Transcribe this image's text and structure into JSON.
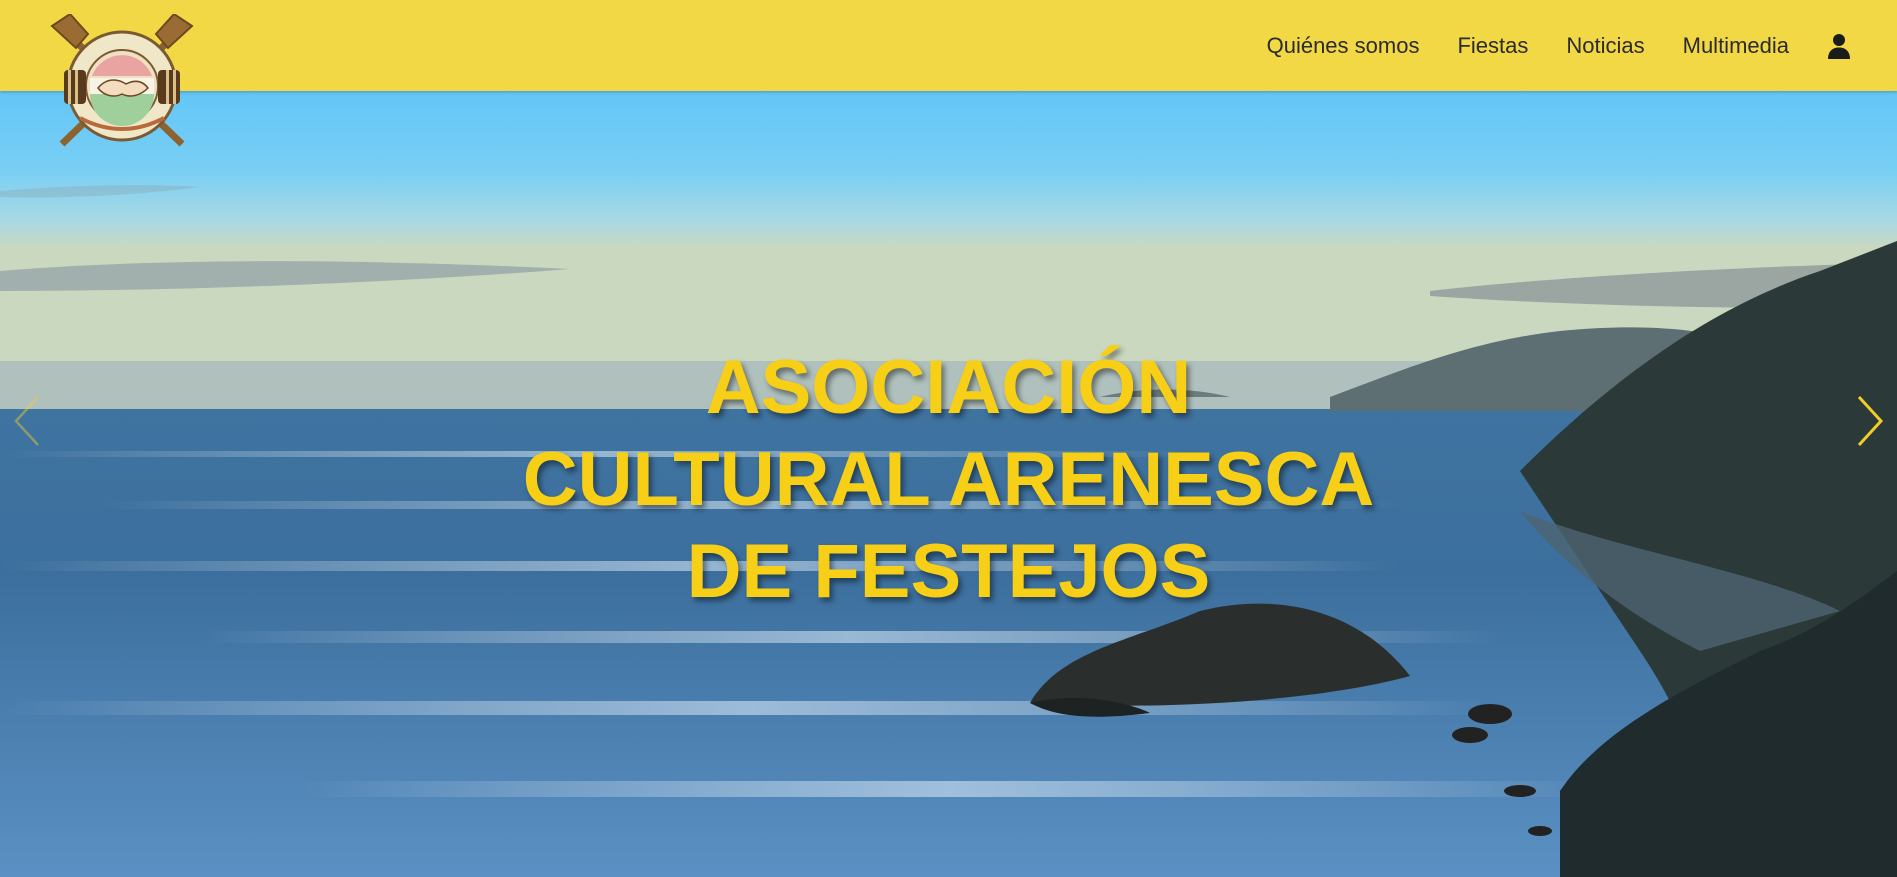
{
  "header": {
    "logo_alt": "Asociación Cultural Arenesca de Festejos logo",
    "nav": [
      {
        "label": "Quiénes somos"
      },
      {
        "label": "Fiestas"
      },
      {
        "label": "Noticias"
      },
      {
        "label": "Multimedia"
      }
    ],
    "user_icon": "user-icon"
  },
  "hero": {
    "title_lines": [
      "ASOCIACIÓN",
      "CULTURAL ARENESCA",
      "DE FESTEJOS"
    ],
    "prev_icon": "chevron-left-icon",
    "next_icon": "chevron-right-icon"
  },
  "colors": {
    "header_bg": "#f3d846",
    "title": "#f7cf16",
    "arrow": "#f2cc2a"
  }
}
